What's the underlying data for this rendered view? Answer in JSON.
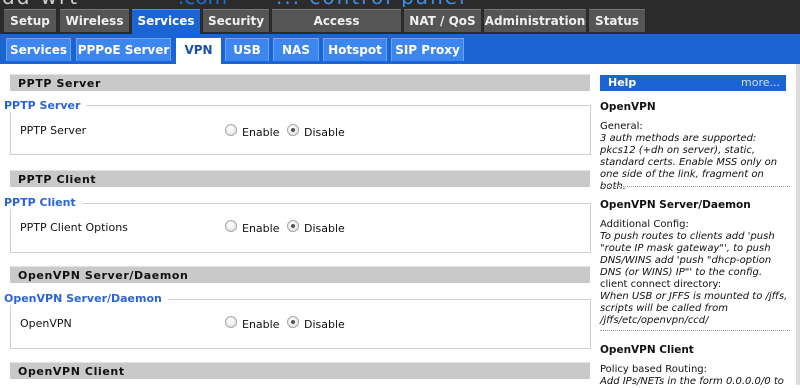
{
  "main_tabs": [
    "Setup",
    "Wireless",
    "Services",
    "Security",
    "Access Restrictions",
    "NAT / QoS",
    "Administration",
    "Status"
  ],
  "main_active": "Services",
  "sub_tabs": [
    "Services",
    "PPPoE Server",
    "VPN",
    "USB",
    "NAS",
    "Hotspot",
    "SIP Proxy"
  ],
  "sub_active": "VPN",
  "sections": [
    {
      "header": "PPTP Server",
      "legend": "PPTP Server",
      "row_label": "PPTP Server",
      "enable": "Enable",
      "disable": "Disable",
      "selected": "Disable"
    },
    {
      "header": "PPTP Client",
      "legend": "PPTP Client",
      "row_label": "PPTP Client Options",
      "enable": "Enable",
      "disable": "Disable",
      "selected": "Disable"
    },
    {
      "header": "OpenVPN Server/Daemon",
      "legend": "OpenVPN Server/Daemon",
      "row_label": "OpenVPN",
      "enable": "Enable",
      "disable": "Disable",
      "selected": "Disable"
    },
    {
      "header": "OpenVPN Client"
    }
  ],
  "help": {
    "title": "Help",
    "more": "more...",
    "blocks": [
      {
        "title": "OpenVPN",
        "lines": [
          {
            "text": "General:",
            "italic": false
          },
          {
            "text": "3 auth methods are supported: pkcs12 (+dh on server), static, standard certs. Enable MSS only on one side of the link, fragment on both.",
            "italic": true
          }
        ]
      },
      {
        "title": "OpenVPN Server/Daemon",
        "lines": [
          {
            "text": "Additional Config:",
            "italic": false
          },
          {
            "text": "To push routes to clients add 'push \"route IP mask gateway\"', to push DNS/WINS add 'push \"dhcp-option DNS (or WINS) IP\"' to the config.",
            "italic": true
          },
          {
            "text": "client connect directory:",
            "italic": false
          },
          {
            "text": "When USB or JFFS is mounted to /jffs, scripts will be called from /jffs/etc/openvpn/ccd/",
            "italic": true
          }
        ]
      },
      {
        "title": "OpenVPN Client",
        "lines": [
          {
            "text": "Policy based Routing:",
            "italic": false
          },
          {
            "text": "Add IPs/NETs in the form 0.0.0.0/0 to",
            "italic": true
          }
        ]
      }
    ]
  }
}
